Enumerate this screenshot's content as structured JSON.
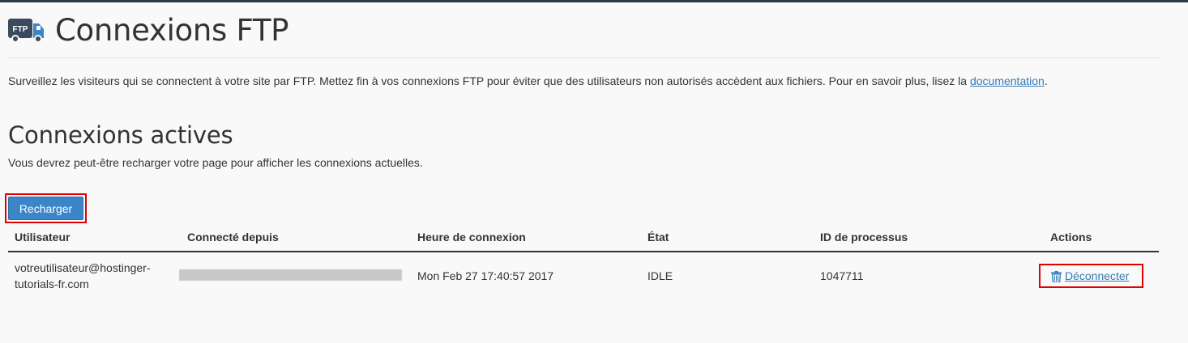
{
  "header": {
    "title": "Connexions FTP",
    "icon": "ftp-truck-icon",
    "icon_label": "FTP"
  },
  "intro": {
    "text": "Surveillez les visiteurs qui se connectent à votre site par FTP. Mettez fin à vos connexions FTP pour éviter que des utilisateurs non autorisés accèdent aux fichiers. Pour en savoir plus, lisez la ",
    "link": "documentation",
    "suffix": "."
  },
  "section": {
    "title": "Connexions actives",
    "hint": "Vous devrez peut-être recharger votre page pour afficher les connexions actuelles."
  },
  "reload_label": "Recharger",
  "table": {
    "headers": [
      "Utilisateur",
      "Connecté depuis",
      "Heure de connexion",
      "État",
      "ID de processus",
      "Actions"
    ],
    "rows": [
      {
        "user": "votreutilisateur@hostinger-tutorials-fr.com",
        "connected_from": "",
        "login_time": "Mon Feb 27 17:40:57 2017",
        "state": "IDLE",
        "pid": "1047711",
        "action_label": "Déconnecter",
        "action_icon": "trash-icon"
      }
    ]
  },
  "colors": {
    "accent": "#337ab7",
    "button": "#3a86c8",
    "highlight": "#e00000",
    "topbar": "#2f3a48"
  }
}
